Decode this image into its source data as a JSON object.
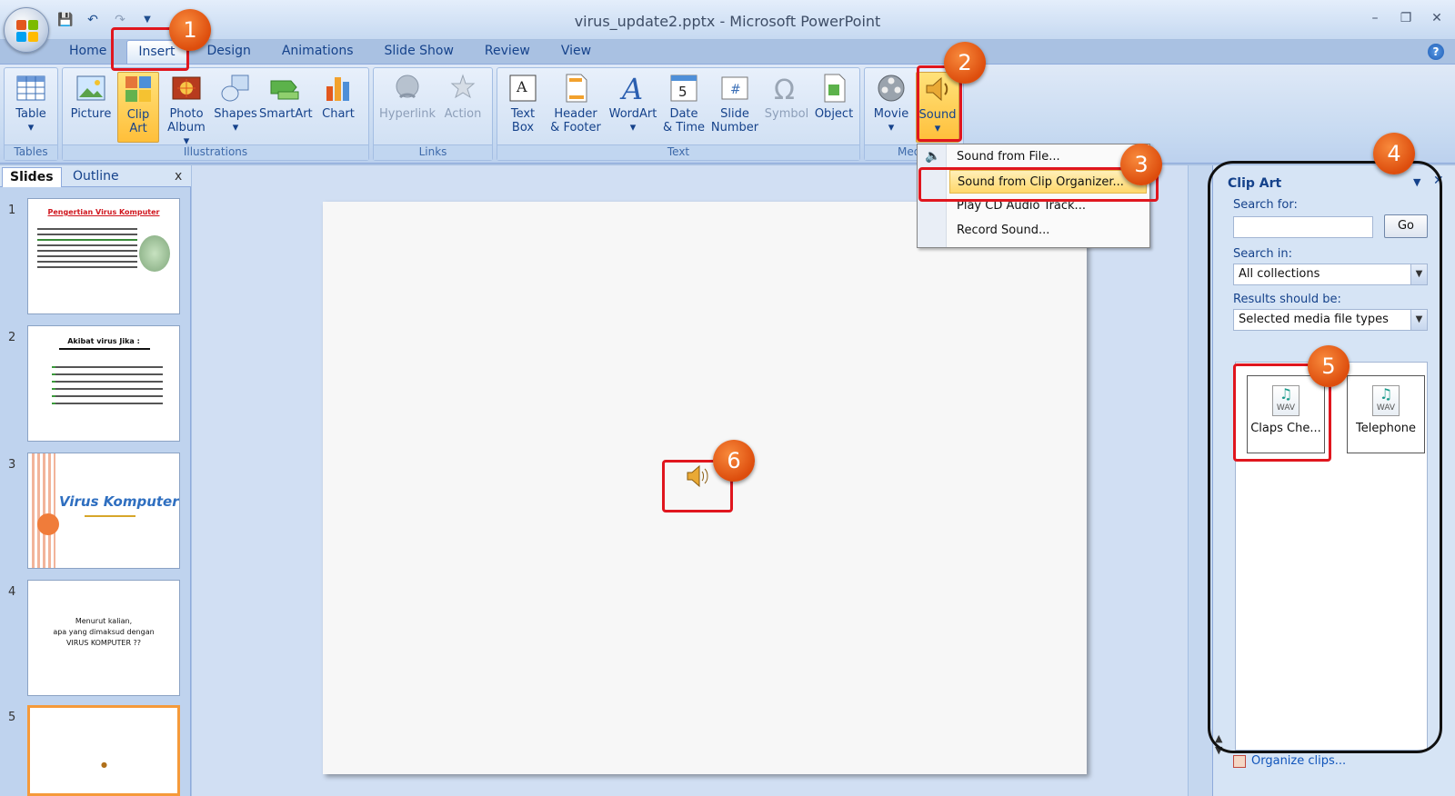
{
  "window": {
    "title": "virus_update2.pptx - Microsoft PowerPoint"
  },
  "tabs": [
    "Home",
    "Insert",
    "Design",
    "Animations",
    "Slide Show",
    "Review",
    "View"
  ],
  "active_tab": "Insert",
  "ribbon": {
    "groups": {
      "tables": "Tables",
      "illustrations": "Illustrations",
      "links": "Links",
      "text": "Text",
      "media": "Media"
    },
    "buttons": {
      "table": "Table",
      "picture": "Picture",
      "clip_art_1": "Clip",
      "clip_art_2": "Art",
      "photo_album_1": "Photo",
      "photo_album_2": "Album",
      "shapes": "Shapes",
      "smartart": "SmartArt",
      "chart": "Chart",
      "hyperlink": "Hyperlink",
      "action": "Action",
      "text_box_1": "Text",
      "text_box_2": "Box",
      "header_footer_1": "Header",
      "header_footer_2": "& Footer",
      "wordart": "WordArt",
      "date_time_1": "Date",
      "date_time_2": "& Time",
      "slide_number_1": "Slide",
      "slide_number_2": "Number",
      "symbol": "Symbol",
      "object": "Object",
      "movie": "Movie",
      "sound": "Sound"
    }
  },
  "sound_menu": {
    "items": [
      "Sound from File...",
      "Sound from Clip Organizer...",
      "Play CD Audio Track...",
      "Record Sound..."
    ],
    "highlighted": "Sound from Clip Organizer..."
  },
  "slides_pane": {
    "tab_slides": "Slides",
    "tab_outline": "Outline",
    "close": "x",
    "slides": [
      {
        "num": "1",
        "title": "Pengertian Virus Komputer"
      },
      {
        "num": "2",
        "title": "Akibat virus Jika :"
      },
      {
        "num": "3",
        "title": "Virus Komputer"
      },
      {
        "num": "4",
        "line1": "Menurut kalian,",
        "line2": "apa yang dimaksud dengan",
        "line3": "VIRUS KOMPUTER ??"
      },
      {
        "num": "5"
      }
    ]
  },
  "clip_art": {
    "title": "Clip Art",
    "search_for_label": "Search for:",
    "search_value": "",
    "go": "Go",
    "search_in_label": "Search in:",
    "search_in_value": "All collections",
    "results_label": "Results should be:",
    "results_value": "Selected media file types",
    "results": [
      {
        "name": "Claps Che...",
        "type": "WAV"
      },
      {
        "name": "Telephone",
        "type": "WAV"
      }
    ],
    "organize": "Organize clips..."
  },
  "callouts": [
    "1",
    "2",
    "3",
    "4",
    "5",
    "6"
  ]
}
